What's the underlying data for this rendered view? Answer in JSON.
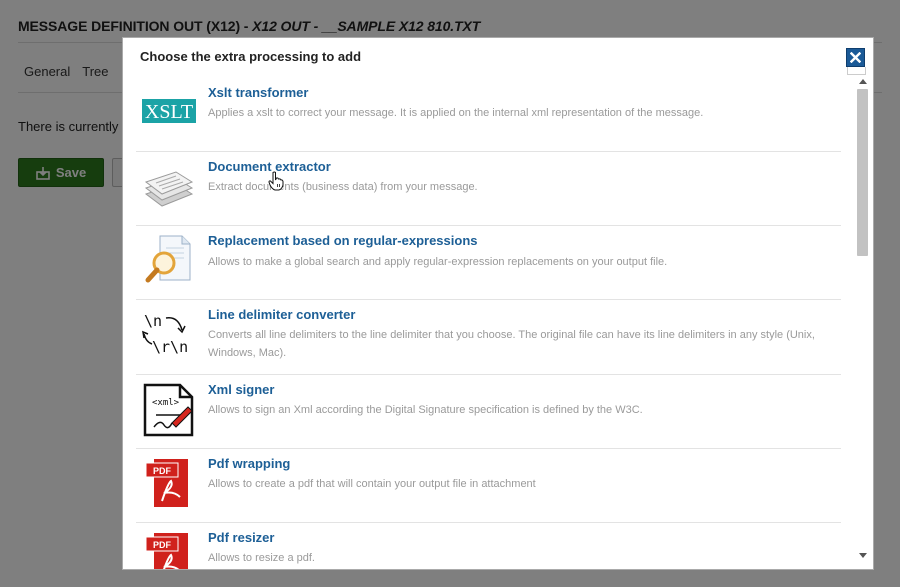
{
  "background": {
    "title_prefix": "MESSAGE DEFINITION OUT (X12) -",
    "title_italic": "X12 OUT - __SAMPLE X12 810.TXT",
    "tabs": [
      "General",
      "Tree"
    ],
    "info_text": "There is currently n",
    "save_label": "Save"
  },
  "modal": {
    "title": "Choose the extra processing to add",
    "close_icon": "close-icon",
    "items": [
      {
        "name": "Xslt transformer",
        "description": "Applies a xslt to correct your message. It is applied on the internal xml representation of the message.",
        "icon": "xslt-icon"
      },
      {
        "name": "Document extractor",
        "description": "Extract documents (business data) from your message.",
        "icon": "documents-stack-icon"
      },
      {
        "name": "Replacement based on regular-expressions",
        "description": "Allows to make a global search and apply regular-expression replacements on your output file.",
        "icon": "magnifier-document-icon"
      },
      {
        "name": "Line delimiter converter",
        "description": "Converts all line delimiters to the line delimiter that you choose. The original file can have its line delimiters in any style (Unix, Windows, Mac).",
        "icon": "line-delimiter-icon"
      },
      {
        "name": "Xml signer",
        "description": "Allows to sign an Xml according the Digital Signature specification is defined by the W3C.",
        "icon": "xml-sign-icon"
      },
      {
        "name": "Pdf wrapping",
        "description": "Allows to create a pdf that will contain your output file in attachment",
        "icon": "pdf-icon"
      },
      {
        "name": "Pdf resizer",
        "description": "Allows to resize a pdf.",
        "icon": "pdf-icon"
      }
    ]
  },
  "colors": {
    "accent": "#1d5f96",
    "save_green": "#2c7a1d",
    "close_blue": "#1b5a97",
    "xslt_teal": "#1ba3a6",
    "pdf_red": "#d0211c"
  }
}
